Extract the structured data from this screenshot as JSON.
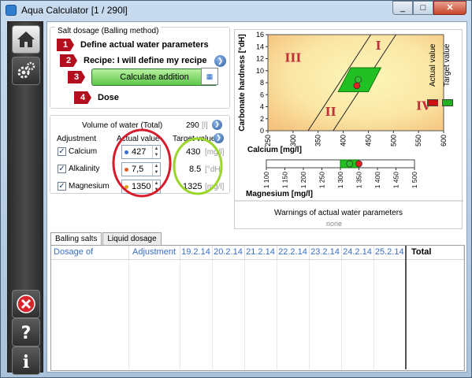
{
  "window": {
    "title": "Aqua Calculator [1 / 290l]",
    "minimize": "_",
    "maximize": "□",
    "close": "✕"
  },
  "sidebar": {
    "home_icon": "home-icon",
    "settings_icon": "gear-icon",
    "close_icon": "close-icon",
    "help_icon": "help-icon",
    "info_icon": "info-icon"
  },
  "salt_dosage": {
    "group_title": "Salt dosage (Balling method)",
    "steps": [
      {
        "num": "1",
        "label": "Define actual water parameters"
      },
      {
        "num": "2",
        "label": "Recipe:   I will define my recipe"
      },
      {
        "num": "3",
        "label": "Calculate addition"
      },
      {
        "num": "4",
        "label": "Dose"
      }
    ]
  },
  "parameters": {
    "volume_label": "Volume of water (Total)",
    "volume_value": "290",
    "volume_unit": "[l]",
    "col_adjustment": "Adjustment",
    "col_actual": "Actual value",
    "col_target": "Target value",
    "rows": [
      {
        "name": "Calcium",
        "actual": "427",
        "target": "430",
        "unit": "[mg/l]",
        "checked": "✓"
      },
      {
        "name": "Alkalinity",
        "actual": "7,5",
        "target": "8.5",
        "unit": "[°dH]",
        "checked": "✓"
      },
      {
        "name": "Magnesium",
        "actual": "1350",
        "target": "1325",
        "unit": "[mg/l]",
        "checked": "✓"
      }
    ]
  },
  "chart_data": [
    {
      "type": "scatter",
      "ylabel": "Carbonate hardness [°dH]",
      "xlabel": "Calcium [mg/l]",
      "ylim": [
        0,
        16
      ],
      "xlim": [
        250,
        600
      ],
      "y_ticks": [
        "0",
        "2",
        "4",
        "6",
        "8",
        "10",
        "12",
        "14",
        "16"
      ],
      "x_ticks": [
        "250",
        "300",
        "350",
        "400",
        "450",
        "500",
        "550",
        "600"
      ],
      "regions": [
        "I",
        "II",
        "III",
        "IV"
      ],
      "series": [
        {
          "name": "Actual value",
          "x": [
            427
          ],
          "y": [
            7.5
          ],
          "color": "#e02020"
        },
        {
          "name": "Target value",
          "x": [
            430
          ],
          "y": [
            8.5
          ],
          "color": "#30c030"
        }
      ]
    },
    {
      "type": "scatter",
      "xlabel": "Magnesium [mg/l]",
      "xlim": [
        1100,
        1500
      ],
      "x_ticks": [
        "1 100",
        "1 150",
        "1 200",
        "1 250",
        "1 300",
        "1 350",
        "1 400",
        "1 450",
        "1 500"
      ],
      "series": [
        {
          "name": "Actual value",
          "x": [
            1350
          ],
          "color": "#e02020"
        },
        {
          "name": "Target value",
          "x": [
            1325
          ],
          "color": "#30c030"
        }
      ]
    }
  ],
  "legend": {
    "actual": "Actual value",
    "target": "Target value",
    "actual_color": "#cc1010",
    "target_color": "#20b020"
  },
  "warnings": {
    "title": "Warnings of actual water parameters",
    "text": "none"
  },
  "tabs": [
    {
      "label": "Balling salts"
    },
    {
      "label": "Liquid dosage"
    }
  ],
  "dosage_table": {
    "headers": [
      "Dosage of",
      "Adjustment",
      "19.2.14",
      "20.2.14",
      "21.2.14",
      "22.2.14",
      "23.2.14",
      "24.2.14",
      "25.2.14",
      "Total"
    ]
  }
}
